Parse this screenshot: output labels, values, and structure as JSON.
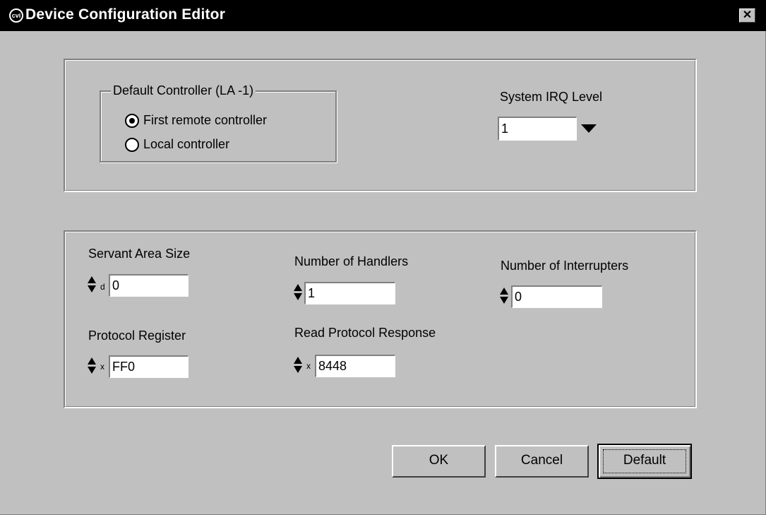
{
  "window": {
    "title": "Device Configuration Editor",
    "app_icon": "cvi-icon",
    "close_glyph": "✕"
  },
  "controller_group": {
    "legend": "Default Controller (LA -1)",
    "options": [
      {
        "label": "First remote controller",
        "checked": true
      },
      {
        "label": "Local controller",
        "checked": false
      }
    ]
  },
  "irq": {
    "label": "System IRQ Level",
    "value": "1"
  },
  "fields": {
    "servant_area": {
      "label": "Servant Area Size",
      "radix": "d",
      "value": "0"
    },
    "handlers": {
      "label": "Number of Handlers",
      "radix": "",
      "value": "1"
    },
    "interrupters": {
      "label": "Number of Interrupters",
      "radix": "",
      "value": "0"
    },
    "protocol_register": {
      "label": "Protocol Register",
      "radix": "x",
      "value": "FF0"
    },
    "read_protocol": {
      "label": "Read Protocol Response",
      "radix": "x",
      "value": "8448"
    }
  },
  "buttons": {
    "ok": "OK",
    "cancel": "Cancel",
    "default": "Default"
  },
  "colors": {
    "face": "#c0c0c0",
    "titlebar": "#000000"
  }
}
